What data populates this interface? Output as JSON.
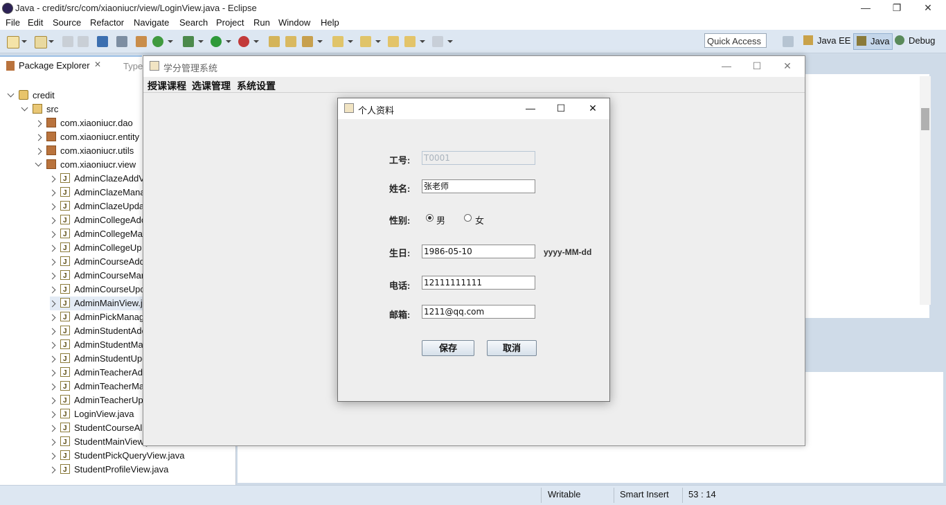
{
  "eclipse": {
    "window_title": "Java - credit/src/com/xiaoniucr/view/LoginView.java - Eclipse",
    "menu": [
      "File",
      "Edit",
      "Source",
      "Refactor",
      "Navigate",
      "Search",
      "Project",
      "Run",
      "Window",
      "Help"
    ],
    "quick_access": "Quick Access",
    "perspectives": [
      "Java EE",
      "Java",
      "Debug"
    ],
    "package_explorer": {
      "tab_label": "Package Explorer",
      "other_tab": "Type",
      "tree": [
        {
          "label": "credit",
          "kind": "project",
          "expanded": true
        },
        {
          "label": "src",
          "kind": "src",
          "expanded": true
        },
        {
          "label": "com.xiaoniucr.dao",
          "kind": "package"
        },
        {
          "label": "com.xiaoniucr.entity",
          "kind": "package"
        },
        {
          "label": "com.xiaoniucr.utils",
          "kind": "package"
        },
        {
          "label": "com.xiaoniucr.view",
          "kind": "package",
          "expanded": true
        },
        {
          "label": "AdminClazeAddV",
          "kind": "java"
        },
        {
          "label": "AdminClazeMana",
          "kind": "java"
        },
        {
          "label": "AdminClazeUpda",
          "kind": "java"
        },
        {
          "label": "AdminCollegeAdc",
          "kind": "java"
        },
        {
          "label": "AdminCollegeMa",
          "kind": "java"
        },
        {
          "label": "AdminCollegeUp",
          "kind": "java"
        },
        {
          "label": "AdminCourseAdd",
          "kind": "java"
        },
        {
          "label": "AdminCourseMar",
          "kind": "java"
        },
        {
          "label": "AdminCourseUpc",
          "kind": "java"
        },
        {
          "label": "AdminMainView.j",
          "kind": "java",
          "selected": true
        },
        {
          "label": "AdminPickManag",
          "kind": "java"
        },
        {
          "label": "AdminStudentAdc",
          "kind": "java"
        },
        {
          "label": "AdminStudentMa",
          "kind": "java"
        },
        {
          "label": "AdminStudentUpc",
          "kind": "java"
        },
        {
          "label": "AdminTeacherAd",
          "kind": "java"
        },
        {
          "label": "AdminTeacherMa",
          "kind": "java"
        },
        {
          "label": "AdminTeacherUp",
          "kind": "java"
        },
        {
          "label": "LoginView.java",
          "kind": "java"
        },
        {
          "label": "StudentCourseAll",
          "kind": "java"
        },
        {
          "label": "StudentMainView.java",
          "kind": "java"
        },
        {
          "label": "StudentPickQueryView.java",
          "kind": "java"
        },
        {
          "label": "StudentProfileView.java",
          "kind": "java"
        }
      ]
    },
    "status": {
      "writable": "Writable",
      "insert_mode": "Smart Insert",
      "position": "53 : 14"
    }
  },
  "app": {
    "title": "学分管理系统",
    "menu": [
      "授课课程",
      "选课管理",
      "系统设置"
    ]
  },
  "dialog": {
    "title": "个人资料",
    "id_label": "工号:",
    "id_value": "T0001",
    "name_label": "姓名:",
    "name_value": "张老师",
    "gender_label": "性别:",
    "gender_options": [
      "男",
      "女"
    ],
    "gender_selected": "男",
    "birthday_label": "生日:",
    "birthday_value": "1986-05-10",
    "birthday_hint": "yyyy-MM-dd",
    "phone_label": "电话:",
    "phone_value": "12111111111",
    "email_label": "邮箱:",
    "email_value": "1211@qq.com",
    "save_label": "保存",
    "cancel_label": "取消"
  }
}
